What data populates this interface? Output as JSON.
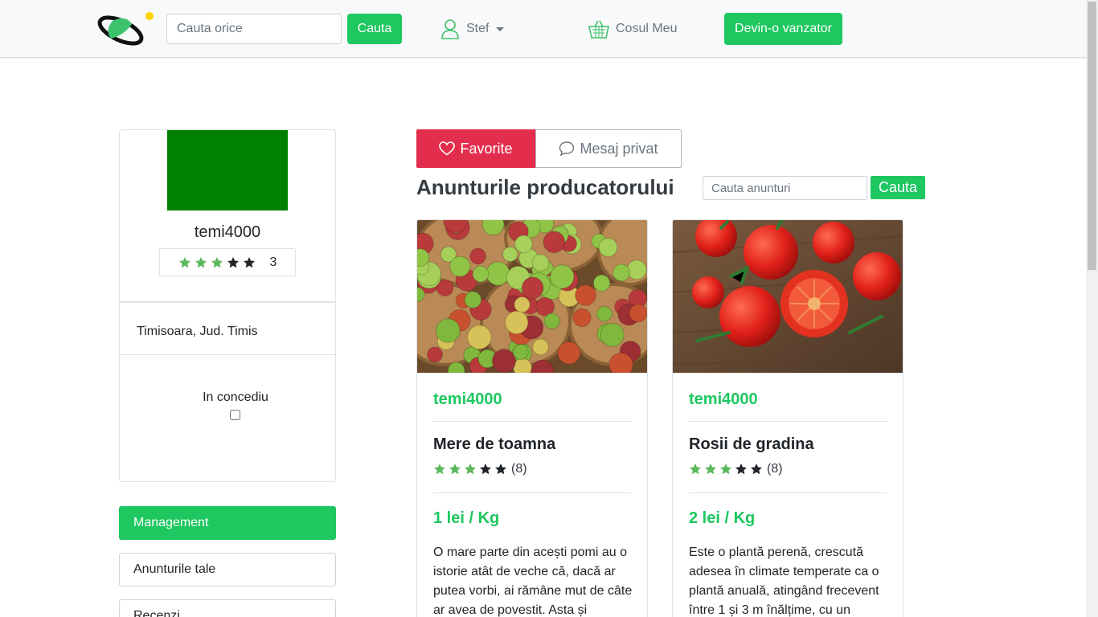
{
  "navbar": {
    "search_placeholder": "Cauta orice",
    "search_button": "Cauta",
    "user_name": "Stef",
    "cart_label": "Cosul Meu",
    "seller_button": "Devin-o vanzator"
  },
  "profile": {
    "username": "temi4000",
    "rating_stars": 3,
    "rating_count": "3",
    "location": "Timisoara, Jud. Timis",
    "vacation_label": "In concediu",
    "vacation_checked": false,
    "avatar_color": "#008000"
  },
  "side_menu": [
    {
      "label": "Management",
      "active": true
    },
    {
      "label": "Anunturile tale",
      "active": false
    },
    {
      "label": "Recenzi",
      "active": false
    }
  ],
  "actions": {
    "favorite_label": "Favorite",
    "message_label": "Mesaj privat"
  },
  "ads": {
    "title": "Anunturile producatorului",
    "search_placeholder": "Cauta anunturi",
    "search_button": "Cauta"
  },
  "products": [
    {
      "seller": "temi4000",
      "title": "Mere de toamna",
      "rating_stars": 3,
      "rating_count": "(8)",
      "price": "1 lei / Kg",
      "description": "O mare parte din acești pomi au o istorie atât de veche că, dacă ar putea vorbi, ai rămâne mut de câte ar avea de povestit. Asta și"
    },
    {
      "seller": "temi4000",
      "title": "Rosii de gradina",
      "rating_stars": 3,
      "rating_count": "(8)",
      "price": "2 lei / Kg",
      "description": "Este o plantă perenă, crescută adesea în climate temperate ca o plantă anuală, atingând frecevent între 1 și 3 m înălțime, cu un"
    }
  ],
  "colors": {
    "accent_green": "#1ec760",
    "favorite_red": "#e32d4d",
    "star_filled": "#5cb85c",
    "star_empty": "#212529"
  }
}
